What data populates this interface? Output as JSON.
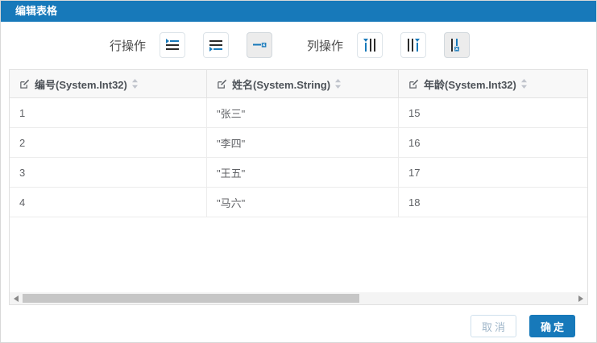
{
  "dialog": {
    "title": "编辑表格"
  },
  "toolbar": {
    "row_ops_label": "行操作",
    "col_ops_label": "列操作",
    "row_buttons": [
      {
        "icon": "insert-row-above-icon",
        "active": false
      },
      {
        "icon": "insert-row-below-icon",
        "active": false
      },
      {
        "icon": "delete-row-icon",
        "active": true
      }
    ],
    "col_buttons": [
      {
        "icon": "insert-col-left-icon",
        "active": false
      },
      {
        "icon": "insert-col-right-icon",
        "active": false
      },
      {
        "icon": "delete-col-icon",
        "active": true
      }
    ]
  },
  "table": {
    "columns": [
      {
        "label": "编号(System.Int32)"
      },
      {
        "label": "姓名(System.String)"
      },
      {
        "label": "年龄(System.Int32)"
      }
    ],
    "rows": [
      [
        "1",
        "\"张三\"",
        "15"
      ],
      [
        "2",
        "\"李四\"",
        "16"
      ],
      [
        "3",
        "\"王五\"",
        "17"
      ],
      [
        "4",
        "\"马六\"",
        "18"
      ]
    ]
  },
  "scrollbar": {
    "orientation": "horizontal",
    "thumb_percent": 61
  },
  "footer": {
    "cancel_label": "取消",
    "ok_label": "确定"
  },
  "colors": {
    "primary": "#1779ba",
    "icon_dark": "#2b2b2b",
    "header_bg": "#f8f8f8",
    "border": "#e3e3e3",
    "active_button_bg": "#ececec",
    "scroll_thumb": "#c6c6c6"
  }
}
